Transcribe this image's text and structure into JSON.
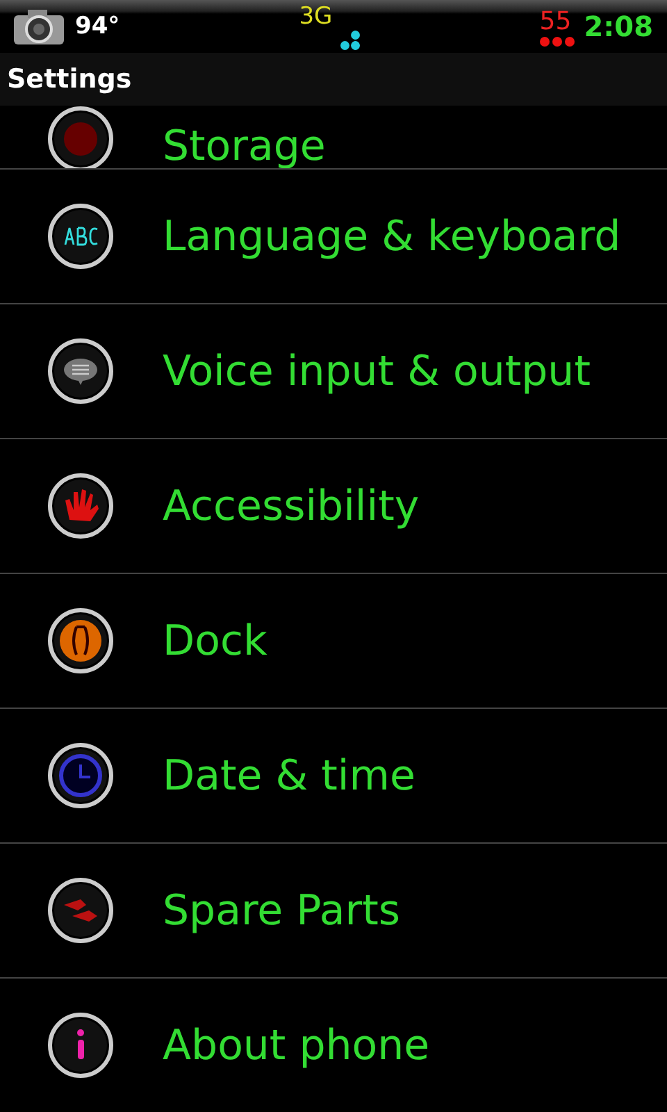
{
  "status_bar": {
    "temperature": "94°",
    "network": "3G",
    "battery": "55",
    "time": "2:08"
  },
  "title_bar": {
    "title": "Settings"
  },
  "items": [
    {
      "label": "Storage",
      "kind": "storage"
    },
    {
      "label": "Language & keyboard",
      "kind": "language"
    },
    {
      "label": "Voice input & output",
      "kind": "voice"
    },
    {
      "label": "Accessibility",
      "kind": "accessibility"
    },
    {
      "label": "Dock",
      "kind": "dock"
    },
    {
      "label": "Date & time",
      "kind": "clock"
    },
    {
      "label": "Spare Parts",
      "kind": "tools"
    },
    {
      "label": "About phone",
      "kind": "info"
    }
  ]
}
